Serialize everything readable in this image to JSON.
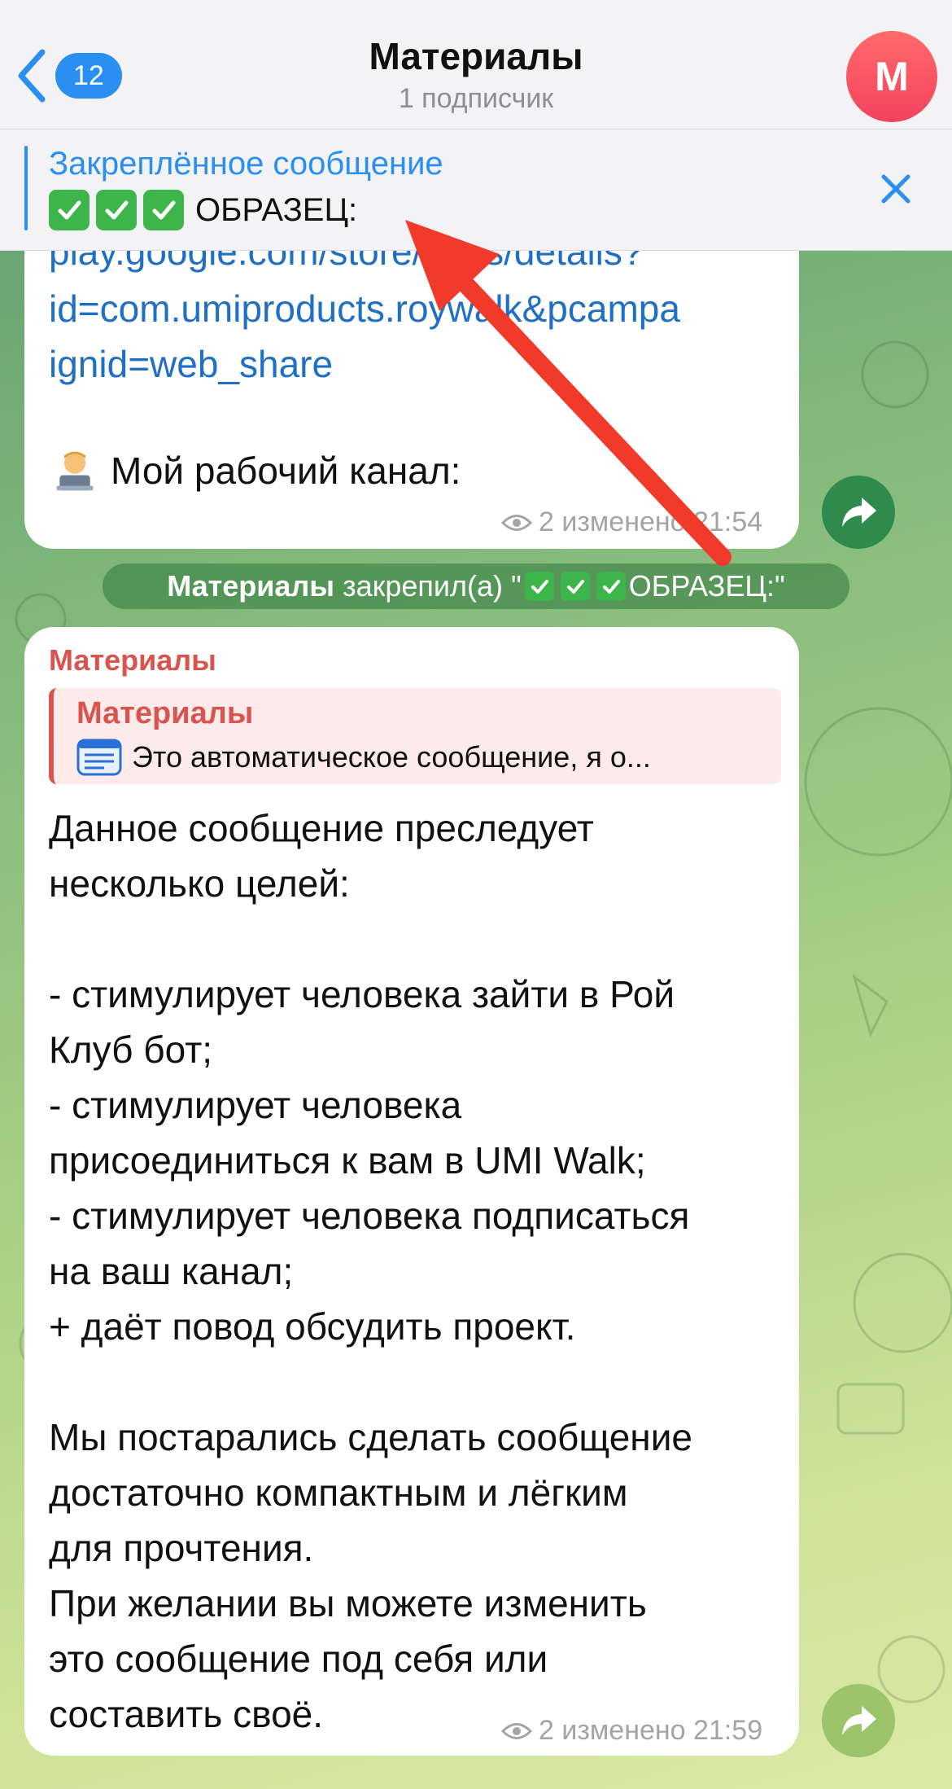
{
  "header": {
    "back_count": "12",
    "title": "Материалы",
    "subtitle": "1 подписчик",
    "avatar_letter": "М"
  },
  "pinned": {
    "label": "Закреплённое сообщение",
    "text": "ОБРАЗЕЦ:"
  },
  "message1": {
    "link_lines": [
      "play.google.com/store/apps/details?",
      "id=com.umiproducts.roywalk&pcampa",
      "ignid=web_share"
    ],
    "text": "Мой рабочий канал:",
    "meta": "2 изменено 21:54"
  },
  "service": {
    "actor": "Материалы",
    "action": "закрепил(а) \"",
    "tail": " ОБРАЗЕЦ:\""
  },
  "message2": {
    "sender": "Материалы",
    "reply_name": "Материалы",
    "reply_text": "Это автоматическое сообщение, я о...",
    "lines": [
      "Данное сообщение преследует",
      "несколько целей:",
      "",
      "- стимулирует человека зайти в Рой",
      "Клуб бот;",
      "- стимулирует человека",
      "присоединиться к вам в UMI Walk;",
      "- стимулирует человека подписаться",
      "на ваш канал;",
      "+ даёт повод обсудить проект.",
      "",
      "Мы постарались сделать сообщение",
      "достаточно компактным и лёгким",
      "для прочтения.",
      "При желании вы можете изменить",
      "это сообщение под себя или",
      "составить своё."
    ],
    "meta": "2 изменено 21:59"
  },
  "colors": {
    "accent": "#2a8ff0",
    "sender": "#d9534f",
    "arrow": "#f23a2a"
  }
}
